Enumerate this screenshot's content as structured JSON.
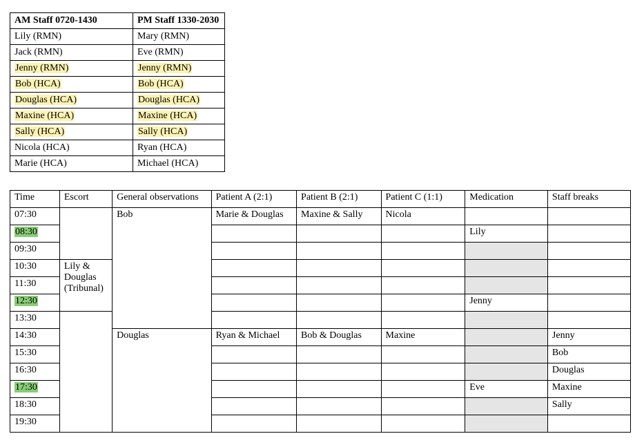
{
  "staff_table": {
    "headers": {
      "am": "AM Staff 0720-1430",
      "pm": "PM Staff 1330-2030"
    },
    "rows": [
      {
        "am": "Lily (RMN)",
        "pm": "Mary (RMN)"
      },
      {
        "am": "Jack (RMN)",
        "pm": "Eve (RMN)"
      },
      {
        "am": "Jenny (RMN)",
        "pm": "Jenny (RMN)",
        "am_hl": true,
        "pm_hl": true
      },
      {
        "am": "Bob (HCA)",
        "pm": "Bob (HCA)",
        "am_hl": true,
        "pm_hl": true
      },
      {
        "am": "Douglas (HCA)",
        "pm": "Douglas (HCA)",
        "am_hl": true,
        "pm_hl": true
      },
      {
        "am": "Maxine (HCA)",
        "pm": "Maxine (HCA)",
        "am_hl": true,
        "pm_hl": true
      },
      {
        "am": "Sally (HCA)",
        "pm": "Sally (HCA)",
        "am_hl": true,
        "pm_hl": true
      },
      {
        "am": "Nicola (HCA)",
        "pm": "Ryan (HCA)"
      },
      {
        "am": "Marie (HCA)",
        "pm": "Michael (HCA)"
      }
    ]
  },
  "schedule": {
    "headers": {
      "time": "Time",
      "escort": "Escort",
      "gen": "General observations",
      "patA": "Patient A (2:1)",
      "patB": "Patient B (2:1)",
      "patC": "Patient C (1:1)",
      "med": "Medication",
      "breaks": "Staff breaks"
    },
    "escort_block1": "Lily & Douglas (Tribunal)",
    "gen_block1": "Bob",
    "gen_block2": "Douglas",
    "rows": {
      "t0730": {
        "time": "07:30",
        "patA": "Marie & Douglas",
        "patB": "Maxine & Sally",
        "patC": "Nicola",
        "med": "",
        "breaks": ""
      },
      "t0830": {
        "time": "08:30",
        "time_hl": true,
        "patA": "",
        "patB": "",
        "patC": "",
        "med": "Lily",
        "breaks": ""
      },
      "t0930": {
        "time": "09:30",
        "patA": "",
        "patB": "",
        "patC": "",
        "med_grey": true,
        "breaks": ""
      },
      "t1030": {
        "time": "10:30",
        "patA": "",
        "patB": "",
        "patC": "",
        "med_grey": true,
        "breaks": ""
      },
      "t1130": {
        "time": "11:30",
        "patA": "",
        "patB": "",
        "patC": "",
        "med_grey": true,
        "breaks": ""
      },
      "t1230": {
        "time": "12:30",
        "time_hl": true,
        "patA": "",
        "patB": "",
        "patC": "",
        "med": "Jenny",
        "breaks": ""
      },
      "t1330": {
        "time": "13:30",
        "patA": "",
        "patB": "",
        "patC": "",
        "med_grey": true,
        "breaks": ""
      },
      "t1430": {
        "time": "14:30",
        "patA": "Ryan & Michael",
        "patB": "Bob & Douglas",
        "patC": "Maxine",
        "med_grey": true,
        "breaks": "Jenny"
      },
      "t1530": {
        "time": "15:30",
        "patA": "",
        "patB": "",
        "patC": "",
        "med_grey": true,
        "breaks": "Bob"
      },
      "t1630": {
        "time": "16:30",
        "patA": "",
        "patB": "",
        "patC": "",
        "med_grey": true,
        "breaks": "Douglas"
      },
      "t1730": {
        "time": "17:30",
        "time_hl": true,
        "patA": "",
        "patB": "",
        "patC": "",
        "med": "Eve",
        "breaks": "Maxine"
      },
      "t1830": {
        "time": "18:30",
        "patA": "",
        "patB": "",
        "patC": "",
        "med_grey": true,
        "breaks": "Sally"
      },
      "t1930": {
        "time": "19:30",
        "patA": "",
        "patB": "",
        "patC": "",
        "med_grey": true,
        "breaks": ""
      }
    }
  }
}
